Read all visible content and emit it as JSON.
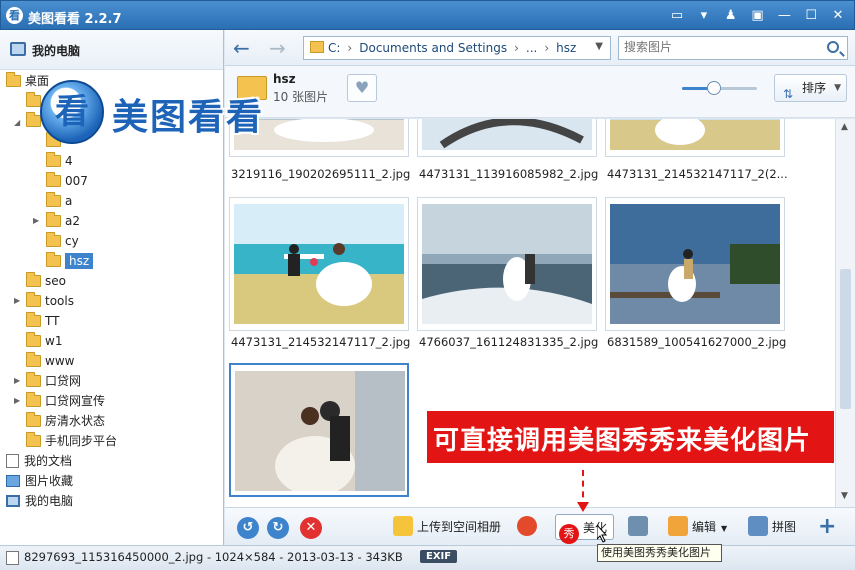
{
  "app": {
    "title": "美图看看 2.2.7",
    "logo_char": "看"
  },
  "window_controls": {
    "chat": "▭",
    "menu": "▾",
    "skin": "♟",
    "restore": "▣",
    "minimize": "—",
    "maximize": "☐",
    "close": "✕"
  },
  "brand": {
    "char": "看",
    "text": "美图看看"
  },
  "sidebar": {
    "header": "我的电脑",
    "items": [
      {
        "label": "桌面"
      },
      {
        "label": "4"
      },
      {
        "label": "007"
      },
      {
        "label": "a"
      },
      {
        "label": "a2"
      },
      {
        "label": "cy"
      },
      {
        "label": "hsz"
      },
      {
        "label": "seo"
      },
      {
        "label": "tools"
      },
      {
        "label": "TT"
      },
      {
        "label": "w1"
      },
      {
        "label": "www"
      },
      {
        "label": "口贷网"
      },
      {
        "label": "口贷网宣传"
      },
      {
        "label": "房清水状态"
      },
      {
        "label": "手机同步平台"
      },
      {
        "label": "我的文档"
      },
      {
        "label": "图片收藏"
      },
      {
        "label": "我的电脑"
      }
    ]
  },
  "nav": {
    "back": "←",
    "forward": "→",
    "crumbs": [
      "C:",
      "Documents and Settings",
      "...",
      "hsz"
    ],
    "search_placeholder": "搜索图片"
  },
  "folder": {
    "name": "hsz",
    "count": "10 张图片"
  },
  "zoom": {
    "level": 0.42
  },
  "sort": {
    "label": "排序"
  },
  "thumbnails": [
    {
      "name": "3219116_190202695111_2.jpg"
    },
    {
      "name": "4473131_113916085982_2.jpg"
    },
    {
      "name": "4473131_214532147117_2(2..."
    },
    {
      "name": "4473131_214532147117_2.jpg"
    },
    {
      "name": "4766037_161124831335_2.jpg"
    },
    {
      "name": "6831589_100541627000_2.jpg"
    },
    {
      "name": "8297693_115316450000_2.jpg"
    }
  ],
  "callout": {
    "text": "可直接调用美图秀秀来美化图片"
  },
  "toolbar": {
    "upload": "上传到空间相册",
    "beautify_icon": "秀",
    "beautify": "美化",
    "edit": "编辑",
    "collage": "拼图",
    "add": "+",
    "tooltip": "使用美图秀秀美化图片"
  },
  "status": {
    "text": "8297693_115316450000_2.jpg - 1024×584 - 2013-03-13 - 343KB",
    "exif": "EXIF"
  }
}
